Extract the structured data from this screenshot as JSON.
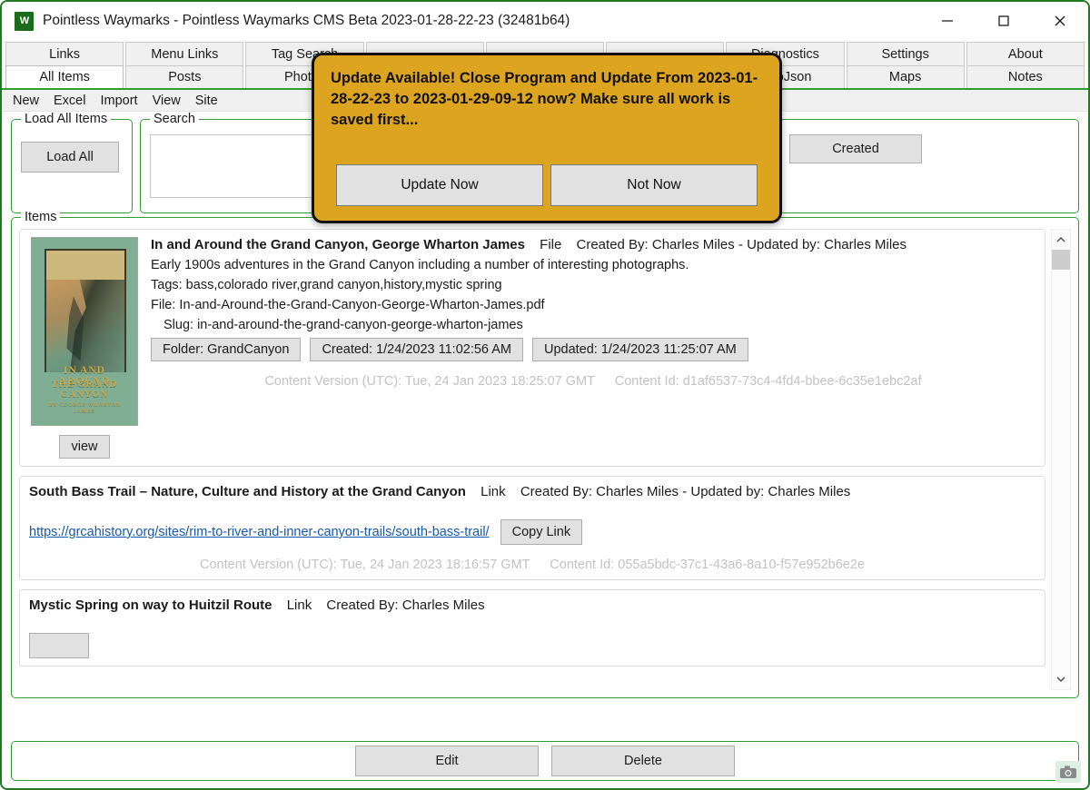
{
  "window": {
    "app_initials": "W",
    "title": "Pointless Waymarks - Pointless Waymarks CMS Beta   2023-01-28-22-23 (32481b64)",
    "minimize": "minimize-icon",
    "maximize": "maximize-icon",
    "close": "close-icon"
  },
  "tabs_row1": [
    {
      "label": "Links",
      "active": false
    },
    {
      "label": "Menu Links",
      "active": false
    },
    {
      "label": "Tag Search",
      "active": false
    },
    {
      "label": "",
      "active": false
    },
    {
      "label": "",
      "active": false
    },
    {
      "label": "",
      "active": false
    },
    {
      "label": "Diagnostics",
      "active": false
    },
    {
      "label": "Settings",
      "active": false
    },
    {
      "label": "About",
      "active": false
    }
  ],
  "tabs_row2": [
    {
      "label": "All Items",
      "active": true
    },
    {
      "label": "Posts",
      "active": false
    },
    {
      "label": "Photos",
      "active": false
    },
    {
      "label": "",
      "active": false
    },
    {
      "label": "",
      "active": false
    },
    {
      "label": "",
      "active": false
    },
    {
      "label": "GeoJson",
      "active": false
    },
    {
      "label": "Maps",
      "active": false
    },
    {
      "label": "Notes",
      "active": false
    }
  ],
  "menu": [
    "New",
    "Excel",
    "Import",
    "View",
    "Site"
  ],
  "load_all_group": {
    "title": "Load All Items",
    "button_label": "Load All"
  },
  "search_group": {
    "title": "Search",
    "value": "",
    "placeholder": ""
  },
  "sort_group": {
    "title": "",
    "created_button_label": "Created"
  },
  "items_group": {
    "title": "Items"
  },
  "items": [
    {
      "title": "In and Around the Grand Canyon, George Wharton James",
      "type": "File",
      "byline": "Created By: Charles Miles - Updated by: Charles Miles",
      "summary": "Early 1900s adventures in the Grand Canyon including a number of interesting photographs.",
      "tags": "Tags: bass,colorado river,grand canyon,history,mystic spring",
      "file": "File: In-and-Around-the-Grand-Canyon-George-Wharton-James.pdf",
      "slug": "Slug: in-and-around-the-grand-canyon-george-wharton-james",
      "pills": [
        "Folder: GrandCanyon",
        "Created: 1/24/2023 11:02:56 AM",
        "Updated: 1/24/2023 11:25:07 AM"
      ],
      "content_version": "Content Version (UTC): Tue, 24 Jan 2023 18:25:07 GMT",
      "content_id": "Content Id: d1af6537-73c4-4fd4-bbee-6c35e1ebc2af",
      "thumb": {
        "view_label": "view",
        "cover_title_line1": "IN AND AROUND",
        "cover_title_line2": "THE GRAND CANYON",
        "cover_author": "BY GEORGE WHARTON JAMES"
      }
    },
    {
      "title": "South Bass Trail – Nature, Culture and History at the Grand Canyon",
      "type": "Link",
      "byline": "Created By: Charles Miles - Updated by: Charles Miles",
      "url": "https://grcahistory.org/sites/rim-to-river-and-inner-canyon-trails/south-bass-trail/",
      "copy_link_label": "Copy Link",
      "content_version": "Content Version (UTC): Tue, 24 Jan 2023 18:16:57 GMT",
      "content_id": "Content Id: 055a5bdc-37c1-43a6-8a10-f57e952b6e2e"
    },
    {
      "title": "Mystic Spring on way to Huitzil Route",
      "type": "Link",
      "byline": "Created By: Charles Miles"
    }
  ],
  "scrollbar": {
    "up": "chevron-up-icon",
    "down": "chevron-down-icon"
  },
  "bottom_bar": {
    "edit_label": "Edit",
    "delete_label": "Delete"
  },
  "dialog": {
    "message": "Update Available! Close Program and Update From 2023-01-28-22-23 to 2023-01-29-09-12 now? Make sure all work is saved first...",
    "update_label": "Update Now",
    "not_now_label": "Not Now",
    "background_color": "#dda51f"
  },
  "overlay": {
    "camera_icon": "camera-icon"
  }
}
